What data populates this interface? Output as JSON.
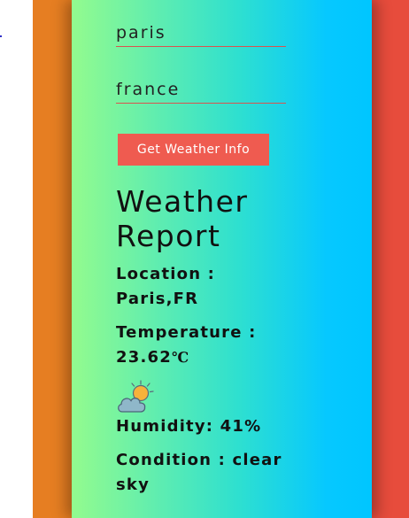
{
  "form": {
    "city_value": "paris",
    "country_value": "france",
    "submit_label": "Get Weather Info"
  },
  "report": {
    "title": "Weather Report",
    "location_text": "Location : Paris,FR",
    "temperature_label": "Temperature : ",
    "temperature_value": "23.62",
    "temperature_unit": "℃",
    "icon": "partly-cloudy-icon",
    "humidity_text": "Humidity: 41%",
    "condition_text": "Condition : clear sky"
  },
  "colors": {
    "left_panel": "#e67e22",
    "right_panel": "#e74c3c",
    "gradient_start": "#93fb8e",
    "gradient_end": "#00c6ff",
    "button": "#ef5b50"
  }
}
